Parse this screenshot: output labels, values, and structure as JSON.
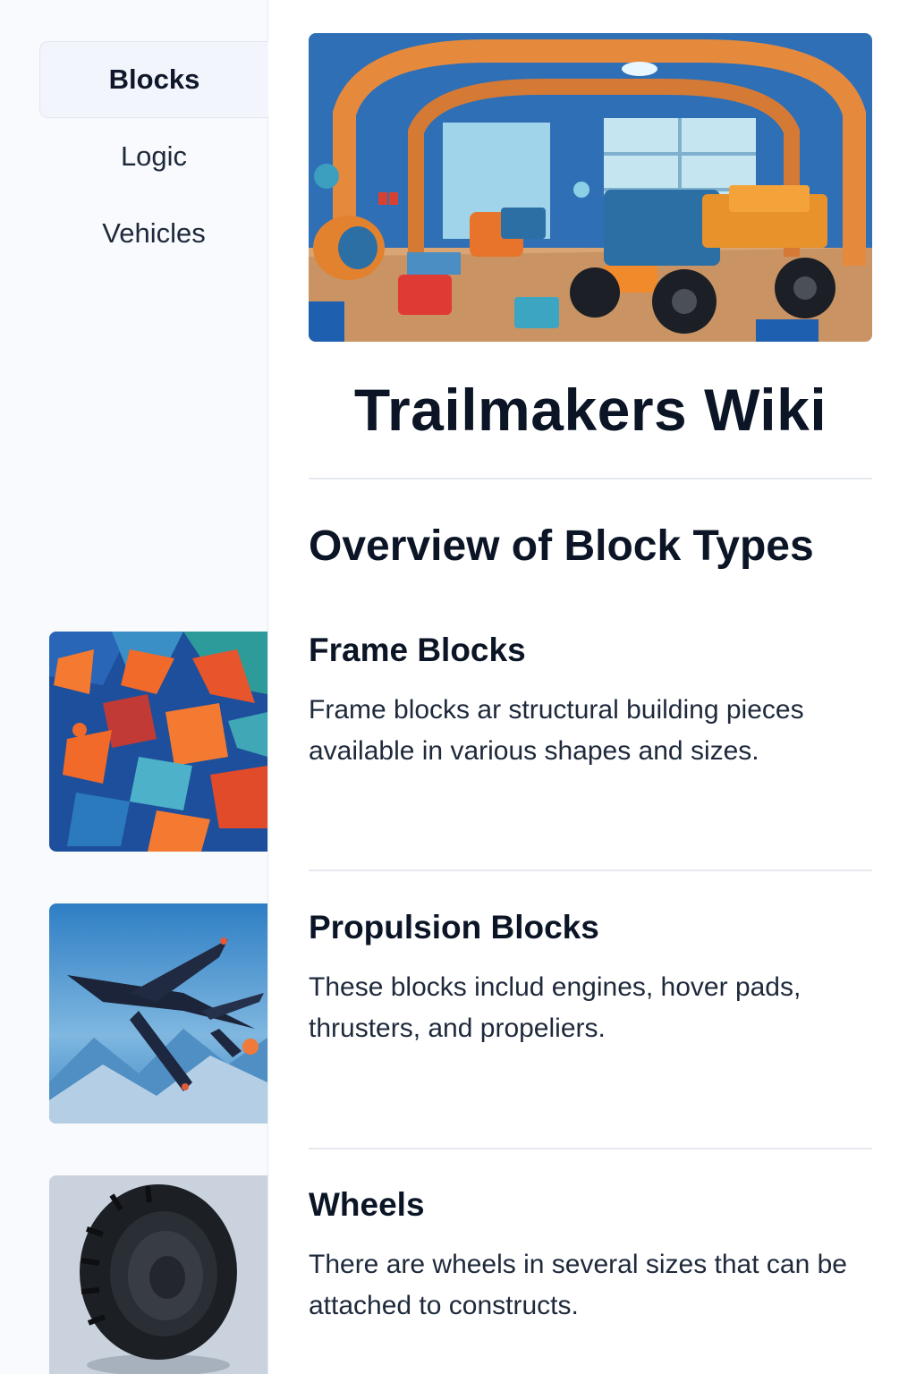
{
  "sidebar": {
    "items": [
      {
        "label": "Blocks",
        "active": true
      },
      {
        "label": "Logic",
        "active": false
      },
      {
        "label": "Vehicles",
        "active": false
      }
    ]
  },
  "main": {
    "title": "Trailmakers Wiki",
    "overview_heading": "Overview of Block Types",
    "sections": [
      {
        "title": "Frame Blocks",
        "text": "Frame blocks ar structural building pieces available in various shapes and sizes."
      },
      {
        "title": "Propulsion Blocks",
        "text": "These blocks includ engines, hover pads, thrusters, and propeliers."
      },
      {
        "title": "Wheels",
        "text": "There are wheels in several sizes that can be attached to constructs."
      }
    ]
  },
  "colors": {
    "sidebar_bg": "#f8fafd",
    "active_item_bg": "#f2f5fb",
    "heading": "#0b1526",
    "divider": "#e5e8ed"
  }
}
